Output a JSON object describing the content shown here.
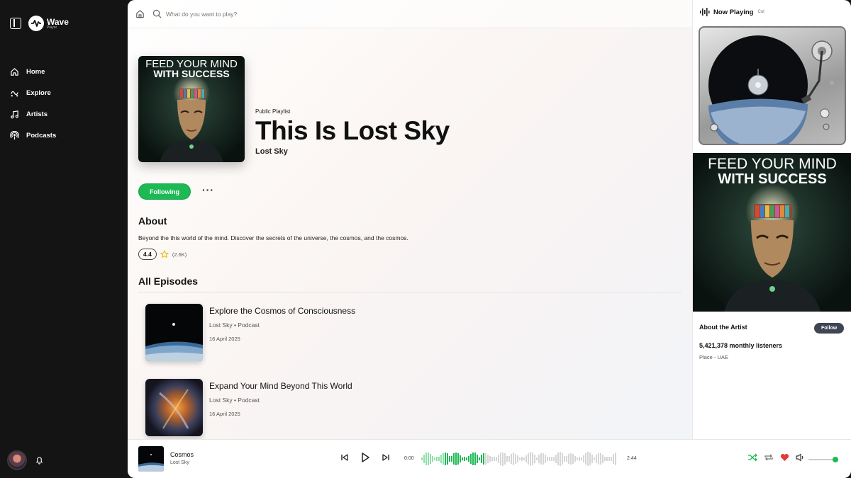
{
  "app": {
    "name": "Wave",
    "subtitle": "Player"
  },
  "sidebar": {
    "items": [
      {
        "label": "Home",
        "icon": "home-icon"
      },
      {
        "label": "Explore",
        "icon": "explore-icon"
      },
      {
        "label": "Artists",
        "icon": "music-note-icon"
      },
      {
        "label": "Podcasts",
        "icon": "podcast-icon"
      }
    ]
  },
  "search": {
    "placeholder": "What do you want to play?"
  },
  "playlist": {
    "type": "Public Playlist",
    "title": "This Is Lost Sky",
    "artist": "Lost Sky",
    "cover_text": [
      "FEED YOUR MIND",
      "WITH SUCCESS"
    ]
  },
  "actions": {
    "follow_label": "Following",
    "more_label": "···"
  },
  "about": {
    "heading": "About",
    "text": "Beyond the this world of the mind. Discover the secrets of the universe, the cosmos, and the cosmos.",
    "rating": "4.4",
    "rating_count": "(2.6K)"
  },
  "episodes": {
    "heading": "All Episodes",
    "items": [
      {
        "title": "Explore the Cosmos of Consciousness",
        "meta": "Lost Sky • Podcast",
        "date": "16 April 2025"
      },
      {
        "title": "Expand Your Mind Beyond This World",
        "meta": "Lost Sky • Podcast",
        "date": "16 April 2025"
      }
    ]
  },
  "now_playing": {
    "label": "Now Playing",
    "extra": "Cut",
    "about_artist": "About the Artist",
    "follow_label": "Follow",
    "listeners": "5,421,378 monthly listeners",
    "place": "Place - UAE"
  },
  "player": {
    "track": "Cosmos",
    "artist": "Lost Sky",
    "elapsed": "0:00",
    "duration": "2:44",
    "volume": 0.95
  },
  "colors": {
    "accent": "#1db954",
    "heart": "#e53935",
    "sidebar": "#141414"
  }
}
